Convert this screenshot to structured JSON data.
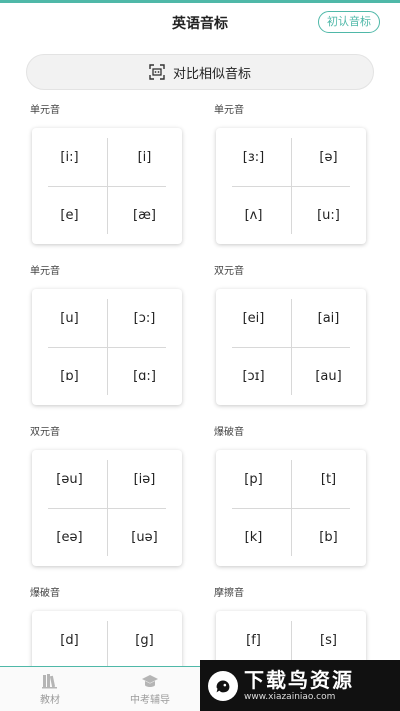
{
  "header": {
    "title": "英语音标",
    "intro_button": "初认音标"
  },
  "compare_button": {
    "label": "对比相似音标",
    "icon": "compare-icon"
  },
  "sections": [
    {
      "label": "单元音",
      "symbols": [
        "[i:]",
        "[i]",
        "[e]",
        "[æ]"
      ]
    },
    {
      "label": "单元音",
      "symbols": [
        "[ɜ:]",
        "[ə]",
        "[ʌ]",
        "[u:]"
      ]
    },
    {
      "label": "单元音",
      "symbols": [
        "[u]",
        "[ɔ:]",
        "[ɒ]",
        "[ɑ:]"
      ]
    },
    {
      "label": "双元音",
      "symbols": [
        "[ei]",
        "[ai]",
        "[ɔɪ]",
        "[au]"
      ]
    },
    {
      "label": "双元音",
      "symbols": [
        "[əu]",
        "[iə]",
        "[eə]",
        "[uə]"
      ]
    },
    {
      "label": "爆破音",
      "symbols": [
        "[p]",
        "[t]",
        "[k]",
        "[b]"
      ]
    },
    {
      "label": "爆破音",
      "symbols": [
        "[d]",
        "[g]",
        "",
        ""
      ]
    },
    {
      "label": "摩擦音",
      "symbols": [
        "[f]",
        "[s]",
        "",
        ""
      ]
    }
  ],
  "tabbar": {
    "tabs": [
      {
        "label": "教材",
        "icon": "books-icon"
      },
      {
        "label": "中考辅导",
        "icon": "graduation-cap-icon"
      }
    ]
  },
  "watermark": {
    "main": "下载鸟资源",
    "sub": "www.xiazainiao.com"
  },
  "colors": {
    "accent": "#4fb8a8"
  }
}
